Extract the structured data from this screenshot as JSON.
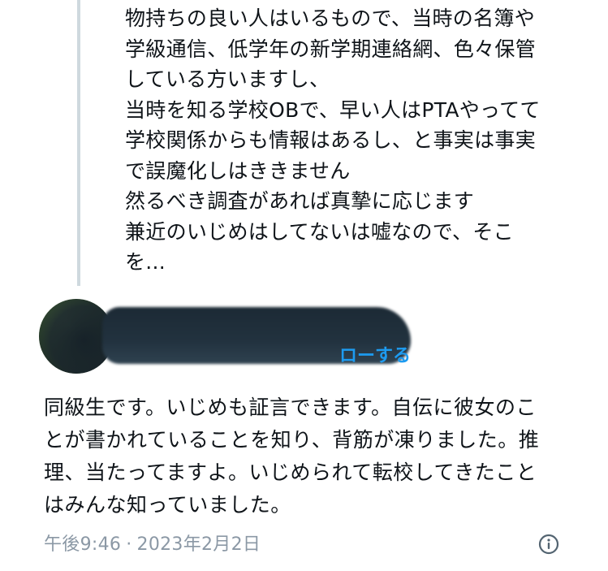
{
  "quoted_tweet": {
    "lines": [
      "物持ちの良い人はいるもので、当時の名簿や",
      "学級通信、低学年の新学期連絡網、色々保管",
      "している方いますし、",
      "当時を知る学校OBで、早い人はPTAやってて",
      "学校関係からも情報はあるし、と事実は事実",
      "で誤魔化しはききません",
      "然るべき調査があれば真摯に応じます",
      "兼近のいじめはしてないは嘘なので、そこ",
      "を..."
    ]
  },
  "author": {
    "follow_label": "ローする",
    "avatar_icon": "avatar-redacted"
  },
  "tweet": {
    "lines": [
      "同級生です。いじめも証言できます。自伝に彼女のこ",
      "とが書かれていることを知り、背筋が凍りました。推",
      "理、当たってますよ。いじめられて転校してきたこと",
      "はみんな知っていました。"
    ],
    "time": "午後9:46",
    "separator": "·",
    "date": "2023年2月2日"
  },
  "icons": {
    "info": "info-circle-icon"
  },
  "colors": {
    "text": "#0f1419",
    "secondary": "#8b98a5",
    "link": "#1d9bf0",
    "thread_line": "#cfd9de"
  }
}
